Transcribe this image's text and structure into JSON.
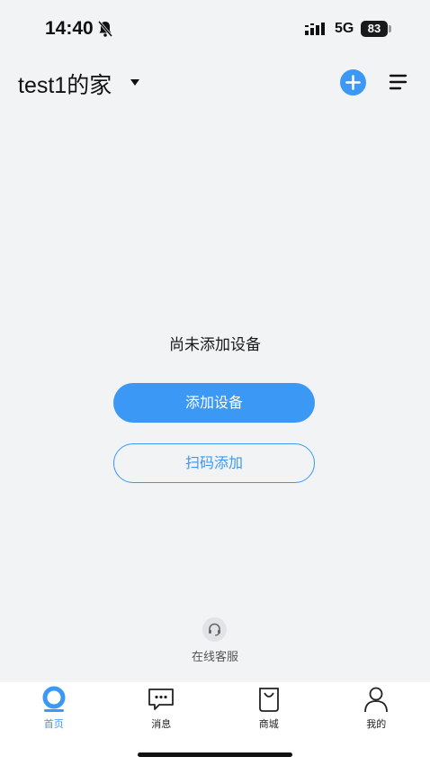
{
  "status_bar": {
    "time": "14:40",
    "network": "5G",
    "battery": "83"
  },
  "header": {
    "title": "test1的家"
  },
  "empty_state": {
    "message": "尚未添加设备",
    "add_device_label": "添加设备",
    "scan_add_label": "扫码添加"
  },
  "support": {
    "label": "在线客服"
  },
  "tab_bar": {
    "active": "home",
    "tabs": [
      {
        "id": "home",
        "label": "首页",
        "icon": "home-icon"
      },
      {
        "id": "messages",
        "label": "消息",
        "icon": "message-icon"
      },
      {
        "id": "mall",
        "label": "商城",
        "icon": "shopping-bag-icon"
      },
      {
        "id": "mine",
        "label": "我的",
        "icon": "profile-icon"
      }
    ]
  },
  "colors": {
    "accent": "#3b99f5",
    "background": "#f2f3f5"
  }
}
